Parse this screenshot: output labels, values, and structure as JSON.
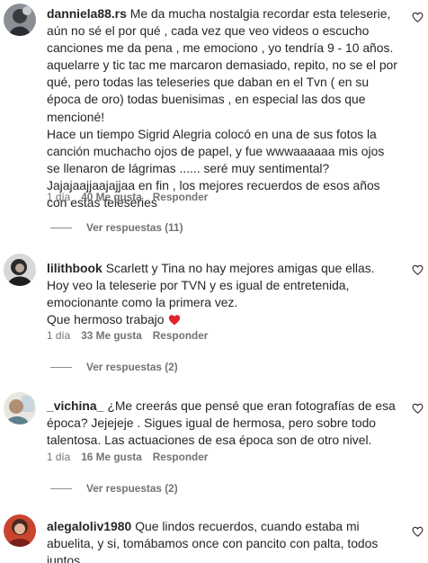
{
  "comments": [
    {
      "username": "danniela88.rs",
      "text": "Me da mucha nostalgia recordar esta teleserie, aún no sé el por qué , cada vez que veo videos o escucho canciones me da pena , me emociono , yo tendría 9 - 10 años. aquelarre y tic tac me marcaron demasiado, repito, no se el por qué, pero todas las teleseries que daban en el Tvn ( en su época de oro) todas buenisimas , en especial las dos que mencioné!",
      "text2": "Hace un tiempo Sigrid Alegria colocó en una de sus fotos la canción muchacho ojos de papel, y fue wwwaaaaaa mis ojos se llenaron de lágrimas ...... seré muy sentimental? Jajajaajjaajajjaa en fin , los mejores recuerdos de esos años con estas teleseries",
      "time": "1 día",
      "likes": "40 Me gusta",
      "reply": "Responder",
      "view_replies": "Ver respuestas (11)"
    },
    {
      "username": "lilithbook",
      "text": "Scarlett y Tina no hay mejores amigas que ellas. Hoy veo la teleserie por TVN y es igual de entretenida, emocionante como la primera vez.",
      "text2": "Que hermoso trabajo",
      "time": "1 día",
      "likes": "33 Me gusta",
      "reply": "Responder",
      "view_replies": "Ver respuestas (2)"
    },
    {
      "username": "_vichina_",
      "text": "¿Me creerás que pensé que eran fotografías de esa época? Jejejeje . Sigues igual de hermosa, pero sobre todo talentosa. Las actuaciones de esa época son de otro nivel.",
      "time": "1 día",
      "likes": "16 Me gusta",
      "reply": "Responder",
      "view_replies": "Ver respuestas (2)"
    },
    {
      "username": "alegaloliv1980",
      "text": "Que lindos recuerdos, cuando estaba mi abuelita, y si, tomábamos once con pancito con palta, todos juntos"
    }
  ],
  "icons": {
    "like": "heart-outline-icon",
    "emoji": "red-heart-emoji"
  },
  "colors": {
    "text": "#262626",
    "muted": "#737373",
    "emoji_heart": "#e0242e"
  }
}
